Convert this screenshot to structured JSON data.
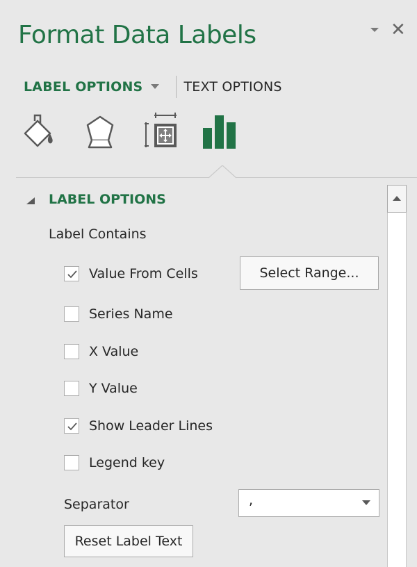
{
  "pane": {
    "title": "Format Data Labels"
  },
  "tabs": {
    "active_label": "LABEL OPTIONS",
    "inactive_label": "TEXT OPTIONS"
  },
  "icon_tabs": [
    "fill-line-icon",
    "effects-icon",
    "size-properties-icon",
    "label-options-icon"
  ],
  "section": {
    "title": "LABEL OPTIONS",
    "label_contains": "Label Contains"
  },
  "checkboxes": [
    {
      "label": "Value From Cells",
      "mnemonic": "F",
      "checked": true
    },
    {
      "label": "Series Name",
      "mnemonic": "S",
      "checked": false
    },
    {
      "label": "X Value",
      "mnemonic": "X",
      "checked": false
    },
    {
      "label": "Y Value",
      "mnemonic": "Y",
      "checked": false
    },
    {
      "label": "Show Leader Lines",
      "mnemonic": "h",
      "checked": true
    },
    {
      "label": "Legend key",
      "mnemonic": "L",
      "checked": false
    }
  ],
  "buttons": {
    "select_range": "Select Range...",
    "reset_label_text": "Reset Label Text"
  },
  "separator": {
    "label": "Separator",
    "value": ","
  },
  "colors": {
    "accent": "#217346",
    "pane_bg": "#e8e8e8"
  }
}
